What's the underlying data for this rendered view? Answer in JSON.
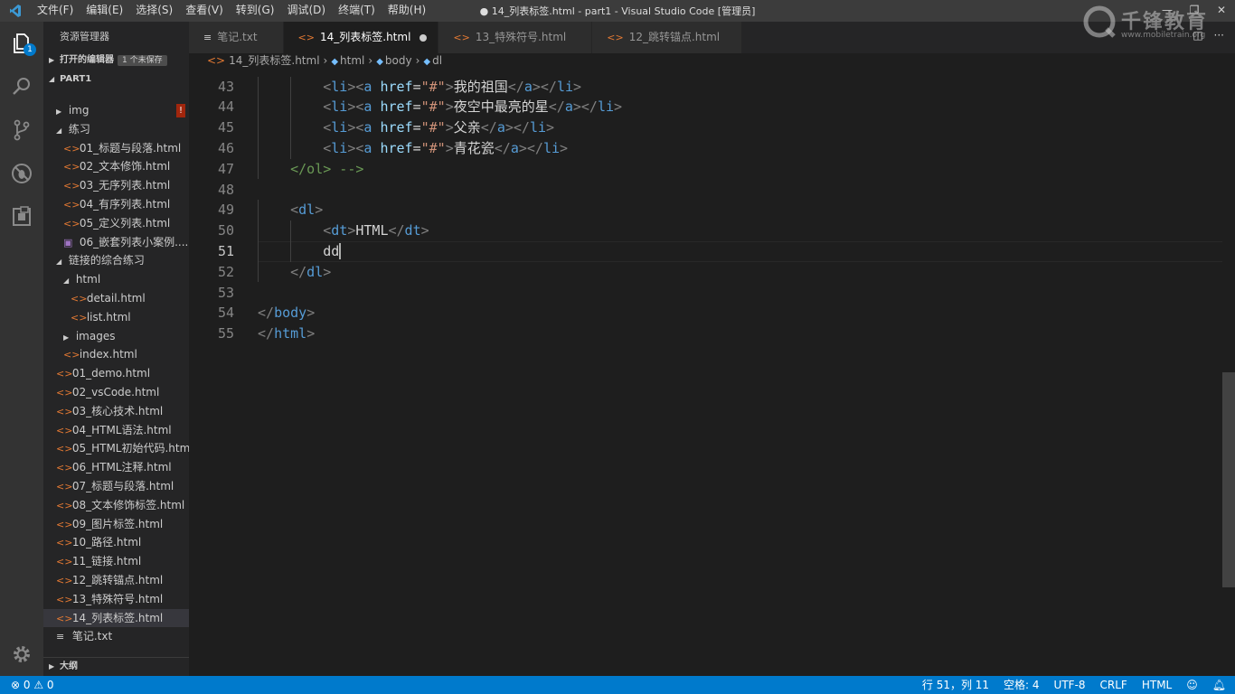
{
  "menu": [
    "文件(F)",
    "编辑(E)",
    "选择(S)",
    "查看(V)",
    "转到(G)",
    "调试(D)",
    "终端(T)",
    "帮助(H)"
  ],
  "window_title": "● 14_列表标签.html - part1 - Visual Studio Code [管理员]",
  "window_controls": {
    "minimize": "—",
    "maximize": "❐",
    "close": "✕"
  },
  "activity": {
    "explorer_badge": "1"
  },
  "sidebar": {
    "title": "资源管理器",
    "open_editors": "打开的编辑器",
    "unsaved": "1 个未保存",
    "workspace": "PART1",
    "outline": "大纲",
    "tree": [
      {
        "label": "img",
        "depth": 0,
        "kind": "folder-closed",
        "error": "!"
      },
      {
        "label": "练习",
        "depth": 0,
        "kind": "folder-open"
      },
      {
        "label": "01_标题与段落.html",
        "depth": 1,
        "kind": "html"
      },
      {
        "label": "02_文本修饰.html",
        "depth": 1,
        "kind": "html"
      },
      {
        "label": "03_无序列表.html",
        "depth": 1,
        "kind": "html"
      },
      {
        "label": "04_有序列表.html",
        "depth": 1,
        "kind": "html"
      },
      {
        "label": "05_定义列表.html",
        "depth": 1,
        "kind": "html"
      },
      {
        "label": "06_嵌套列表小案例....",
        "depth": 1,
        "kind": "image"
      },
      {
        "label": "链接的综合练习",
        "depth": 0,
        "kind": "folder-open"
      },
      {
        "label": "html",
        "depth": 1,
        "kind": "folder-open"
      },
      {
        "label": "detail.html",
        "depth": 2,
        "kind": "html"
      },
      {
        "label": "list.html",
        "depth": 2,
        "kind": "html"
      },
      {
        "label": "images",
        "depth": 1,
        "kind": "folder-closed"
      },
      {
        "label": "index.html",
        "depth": 1,
        "kind": "html"
      },
      {
        "label": "01_demo.html",
        "depth": 0,
        "kind": "html"
      },
      {
        "label": "02_vsCode.html",
        "depth": 0,
        "kind": "html"
      },
      {
        "label": "03_核心技术.html",
        "depth": 0,
        "kind": "html"
      },
      {
        "label": "04_HTML语法.html",
        "depth": 0,
        "kind": "html"
      },
      {
        "label": "05_HTML初始代码.html",
        "depth": 0,
        "kind": "html"
      },
      {
        "label": "06_HTML注释.html",
        "depth": 0,
        "kind": "html"
      },
      {
        "label": "07_标题与段落.html",
        "depth": 0,
        "kind": "html"
      },
      {
        "label": "08_文本修饰标签.html",
        "depth": 0,
        "kind": "html"
      },
      {
        "label": "09_图片标签.html",
        "depth": 0,
        "kind": "html"
      },
      {
        "label": "10_路径.html",
        "depth": 0,
        "kind": "html"
      },
      {
        "label": "11_链接.html",
        "depth": 0,
        "kind": "html"
      },
      {
        "label": "12_跳转锚点.html",
        "depth": 0,
        "kind": "html"
      },
      {
        "label": "13_特殊符号.html",
        "depth": 0,
        "kind": "html"
      },
      {
        "label": "14_列表标签.html",
        "depth": 0,
        "kind": "html",
        "selected": true
      },
      {
        "label": "笔记.txt",
        "depth": 0,
        "kind": "txt"
      }
    ]
  },
  "tabs": [
    {
      "label": "笔记.txt",
      "kind": "txt",
      "active": false
    },
    {
      "label": "14_列表标签.html",
      "kind": "html",
      "active": true,
      "dirty": true
    },
    {
      "label": "13_特殊符号.html",
      "kind": "html",
      "active": false
    },
    {
      "label": "12_跳转锚点.html",
      "kind": "html",
      "active": false
    }
  ],
  "breadcrumb": [
    "14_列表标签.html",
    "html",
    "body",
    "dl"
  ],
  "code": [
    {
      "n": "43",
      "indent": 2,
      "parts": [
        [
          "brk",
          "<"
        ],
        [
          "tag",
          "li"
        ],
        [
          "brk",
          "><"
        ],
        [
          "tag",
          "a"
        ],
        [
          "txt",
          " "
        ],
        [
          "attr",
          "href"
        ],
        [
          "txt",
          "="
        ],
        [
          "str",
          "\"#\""
        ],
        [
          "brk",
          ">"
        ],
        [
          "txt",
          "我的祖国"
        ],
        [
          "brk",
          "</"
        ],
        [
          "tag",
          "a"
        ],
        [
          "brk",
          "></"
        ],
        [
          "tag",
          "li"
        ],
        [
          "brk",
          ">"
        ]
      ]
    },
    {
      "n": "44",
      "indent": 2,
      "parts": [
        [
          "brk",
          "<"
        ],
        [
          "tag",
          "li"
        ],
        [
          "brk",
          "><"
        ],
        [
          "tag",
          "a"
        ],
        [
          "txt",
          " "
        ],
        [
          "attr",
          "href"
        ],
        [
          "txt",
          "="
        ],
        [
          "str",
          "\"#\""
        ],
        [
          "brk",
          ">"
        ],
        [
          "txt",
          "夜空中最亮的星"
        ],
        [
          "brk",
          "</"
        ],
        [
          "tag",
          "a"
        ],
        [
          "brk",
          "></"
        ],
        [
          "tag",
          "li"
        ],
        [
          "brk",
          ">"
        ]
      ]
    },
    {
      "n": "45",
      "indent": 2,
      "parts": [
        [
          "brk",
          "<"
        ],
        [
          "tag",
          "li"
        ],
        [
          "brk",
          "><"
        ],
        [
          "tag",
          "a"
        ],
        [
          "txt",
          " "
        ],
        [
          "attr",
          "href"
        ],
        [
          "txt",
          "="
        ],
        [
          "str",
          "\"#\""
        ],
        [
          "brk",
          ">"
        ],
        [
          "txt",
          "父亲"
        ],
        [
          "brk",
          "</"
        ],
        [
          "tag",
          "a"
        ],
        [
          "brk",
          "></"
        ],
        [
          "tag",
          "li"
        ],
        [
          "brk",
          ">"
        ]
      ]
    },
    {
      "n": "46",
      "indent": 2,
      "parts": [
        [
          "brk",
          "<"
        ],
        [
          "tag",
          "li"
        ],
        [
          "brk",
          "><"
        ],
        [
          "tag",
          "a"
        ],
        [
          "txt",
          " "
        ],
        [
          "attr",
          "href"
        ],
        [
          "txt",
          "="
        ],
        [
          "str",
          "\"#\""
        ],
        [
          "brk",
          ">"
        ],
        [
          "txt",
          "青花瓷"
        ],
        [
          "brk",
          "</"
        ],
        [
          "tag",
          "a"
        ],
        [
          "brk",
          "></"
        ],
        [
          "tag",
          "li"
        ],
        [
          "brk",
          ">"
        ]
      ]
    },
    {
      "n": "47",
      "indent": 1,
      "parts": [
        [
          "cmt",
          "</ol> -->"
        ]
      ]
    },
    {
      "n": "48",
      "indent": 0,
      "parts": []
    },
    {
      "n": "49",
      "indent": 1,
      "parts": [
        [
          "brk",
          "<"
        ],
        [
          "tag",
          "dl"
        ],
        [
          "brk",
          ">"
        ]
      ]
    },
    {
      "n": "50",
      "indent": 2,
      "parts": [
        [
          "brk",
          "<"
        ],
        [
          "tag",
          "dt"
        ],
        [
          "brk",
          ">"
        ],
        [
          "txt",
          "HTML"
        ],
        [
          "brk",
          "</"
        ],
        [
          "tag",
          "dt"
        ],
        [
          "brk",
          ">"
        ]
      ]
    },
    {
      "n": "51",
      "indent": 2,
      "parts": [
        [
          "txt",
          "dd"
        ]
      ],
      "current": true
    },
    {
      "n": "52",
      "indent": 1,
      "parts": [
        [
          "brk",
          "</"
        ],
        [
          "tag",
          "dl"
        ],
        [
          "brk",
          ">"
        ]
      ]
    },
    {
      "n": "53",
      "indent": 0,
      "parts": []
    },
    {
      "n": "54",
      "indent": 0,
      "parts": [
        [
          "brk",
          "</"
        ],
        [
          "tag",
          "body"
        ],
        [
          "brk",
          ">"
        ]
      ]
    },
    {
      "n": "55",
      "indent": 0,
      "parts": [
        [
          "brk",
          "</"
        ],
        [
          "tag",
          "html"
        ],
        [
          "brk",
          ">"
        ]
      ]
    }
  ],
  "status": {
    "errors": "⊗ 0",
    "warnings": "⚠ 0",
    "position": "行 51，列 11",
    "spaces": "空格: 4",
    "encoding": "UTF-8",
    "eol": "CRLF",
    "language": "HTML"
  },
  "watermark": {
    "brand": "千锋教育",
    "url": "www.mobiletrain.org"
  }
}
